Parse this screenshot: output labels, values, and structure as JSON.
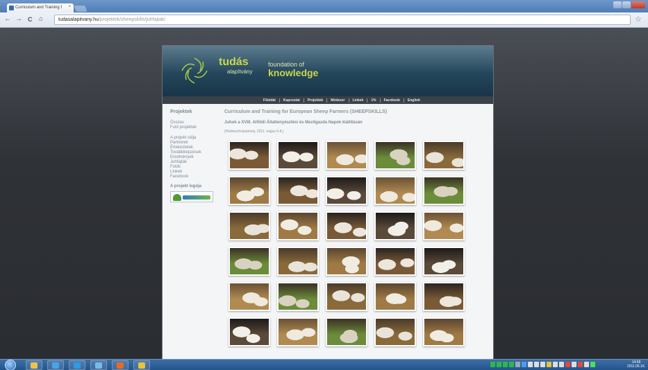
{
  "browser": {
    "tab_title": "Curriculum and Training f",
    "tab_close": "×",
    "url_host": "tudasalapitvany.hu",
    "url_path": "/projektek/sheepskills/juhfajtak/",
    "nav_back": "←",
    "nav_forward": "→",
    "nav_reload": "C",
    "nav_home": "⌂",
    "star": "☆"
  },
  "site": {
    "logo": {
      "tudas": "tudás",
      "alapitvany": "alapítvány",
      "foundation": "foundation of",
      "knowledge": "knowledge"
    },
    "menu": [
      "Főoldal",
      "Kapcsolat",
      "Projektek",
      "Módszer",
      "Linkek",
      "1%",
      "Facebook",
      "English"
    ],
    "sidebar": {
      "title": "Projektek",
      "group1": [
        "Összes",
        "Futó projektek"
      ],
      "group2": [
        "A projekt célja",
        "Partnerek",
        "Értekezletek",
        "Továbbképzések",
        "Eredmények",
        "Juhfajták",
        "Fotók",
        "Linkek",
        "Facebook"
      ],
      "logo_title": "A projekt logója"
    },
    "content": {
      "title": "Curriculum and Training for European Sheep Farmers (SHEEPSKILLS)",
      "subtitle": "Juhok a XVIII. Alföldi Állattenyésztési és Mezőgazda Napok kiállításán",
      "note": "(Hódmezővásárhely, 2011. május 6-8.)"
    },
    "gallery_count": 30
  },
  "colors": {
    "banner_top": "#5d7c8e",
    "banner_bottom": "#193548",
    "logo_green": "#c8d84a",
    "menu_bg": "#3a4148",
    "taskbar": "#23558c"
  },
  "taskbar": {
    "apps": [
      "explorer-icon",
      "ie-icon",
      "skype-icon",
      "media-icon",
      "office-icon",
      "chrome-icon"
    ],
    "time": "14:58",
    "date": "2011.05.16."
  }
}
